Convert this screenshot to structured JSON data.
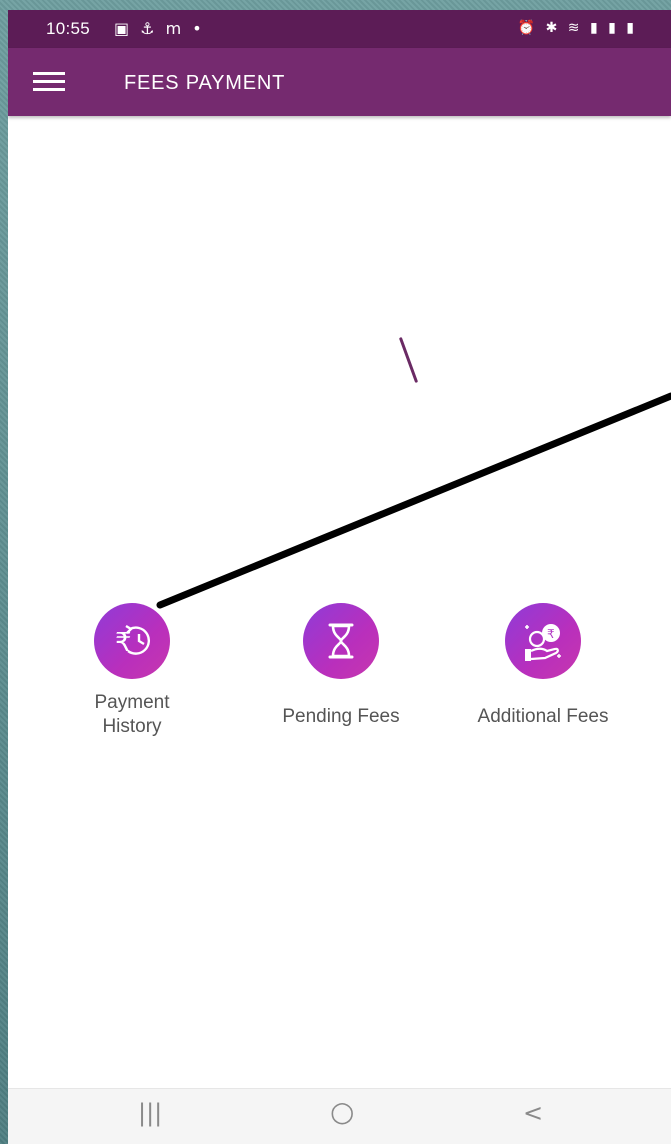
{
  "status_bar": {
    "time": "10:55",
    "left_icons": "▣ ⚓ m •",
    "right_icons": "⏰ ✱ ≋ ▮ ▮ ▮"
  },
  "app_bar": {
    "title": "FEES PAYMENT"
  },
  "features": [
    {
      "line1": "Payment",
      "line2": "History",
      "icon": "rupee-history-icon"
    },
    {
      "label": "Pending Fees",
      "icon": "hourglass-icon"
    },
    {
      "label": "Additional Fees",
      "icon": "coins-hand-icon"
    }
  ],
  "nav": {
    "recents": "|||",
    "home": "○",
    "back": "<"
  },
  "colors": {
    "status_bar": "#5c1c56",
    "app_bar": "#752a6f",
    "icon_gradient_start": "#8f3bd8",
    "icon_gradient_end": "#c737ae"
  }
}
